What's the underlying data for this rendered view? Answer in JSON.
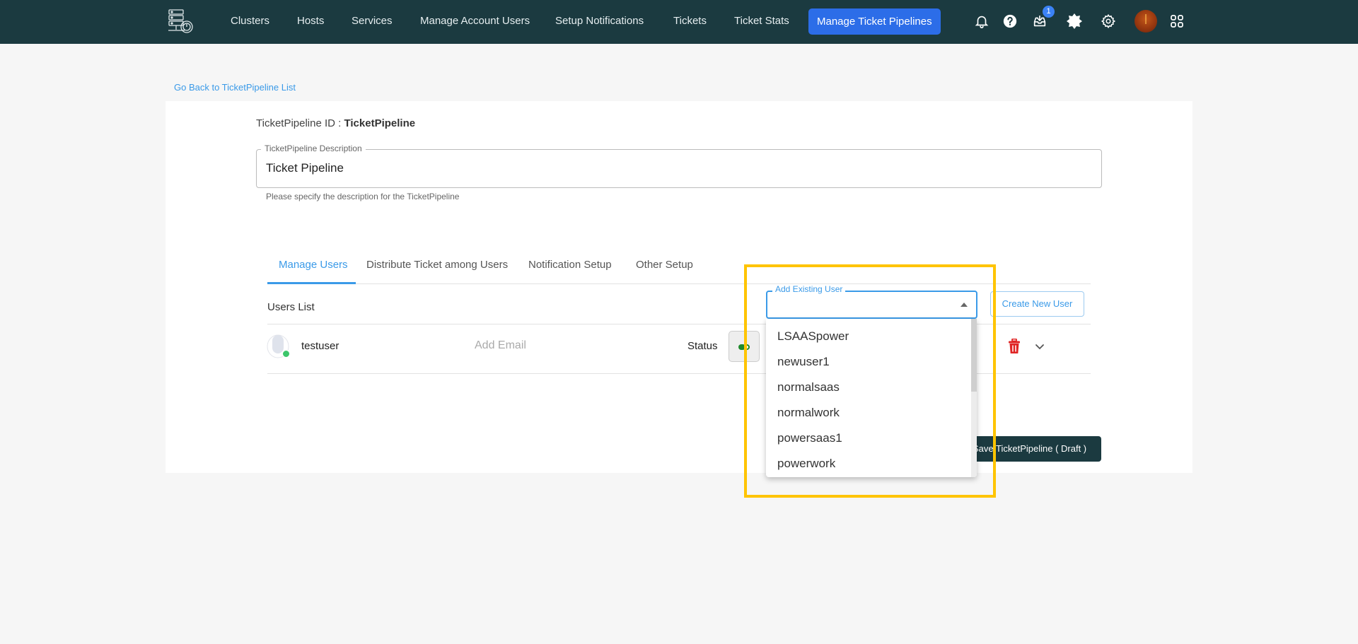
{
  "nav": {
    "items": [
      "Clusters",
      "Hosts",
      "Services",
      "Manage Account Users",
      "Setup Notifications",
      "Tickets",
      "Ticket Stats"
    ],
    "active": "Manage Ticket Pipelines",
    "inbox_badge": "1",
    "icons": [
      "bell-icon",
      "help-icon",
      "inbox-download-icon",
      "theme-toggle-icon",
      "settings-gear-icon",
      "user-avatar",
      "apps-grid-icon"
    ]
  },
  "page": {
    "back_link": "Go Back to TicketPipeline List",
    "pipeline_id_label": "TicketPipeline ID : ",
    "pipeline_id_value": "TicketPipeline",
    "description": {
      "label": "TicketPipeline Description",
      "value": "Ticket Pipeline",
      "help": "Please specify the description for the TicketPipeline"
    },
    "tabs": [
      "Manage Users",
      "Distribute Ticket among Users",
      "Notification Setup",
      "Other Setup"
    ],
    "active_tab": "Manage Users",
    "users_list_title": "Users List",
    "add_existing_user": {
      "label": "Add Existing User",
      "value": "",
      "options": [
        "LSAASpower",
        "newuser1",
        "normalsaas",
        "normalwork",
        "powersaas1",
        "powerwork"
      ]
    },
    "create_new_user": "Create New User",
    "users": [
      {
        "name": "testuser",
        "email_placeholder": "Add Email",
        "status_label": "Status",
        "status_active": true
      }
    ],
    "save_button": "Save TicketPipeline ( Draft )"
  },
  "colors": {
    "nav_bg": "#1b3a40",
    "active_nav": "#2c6de8",
    "accent": "#3a9ae8",
    "delete": "#e02424",
    "status_on": "#1f8a2c",
    "highlight": "#ffc400"
  }
}
